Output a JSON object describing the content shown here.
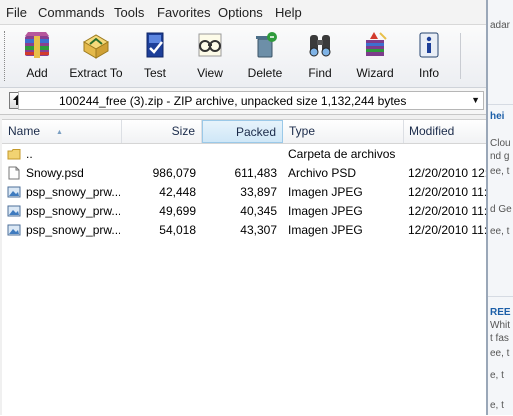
{
  "menu": [
    "File",
    "Commands",
    "Tools",
    "Favorites",
    "Options",
    "Help"
  ],
  "toolbar": [
    {
      "label": "Add",
      "icon": "add-icon"
    },
    {
      "label": "Extract To",
      "icon": "extract-to-icon"
    },
    {
      "label": "Test",
      "icon": "test-icon"
    },
    {
      "label": "View",
      "icon": "view-icon"
    },
    {
      "label": "Delete",
      "icon": "delete-icon"
    },
    {
      "label": "Find",
      "icon": "find-icon"
    },
    {
      "label": "Wizard",
      "icon": "wizard-icon"
    },
    {
      "label": "Info",
      "icon": "info-icon"
    }
  ],
  "path": {
    "text": "100244_free (3).zip - ZIP archive, unpacked size 1,132,244 bytes"
  },
  "columns": {
    "name": "Name",
    "size": "Size",
    "packed": "Packed",
    "type": "Type",
    "modified": "Modified"
  },
  "files": [
    {
      "name": "..",
      "size": "",
      "packed": "",
      "type": "Carpeta de archivos",
      "modified": "",
      "icon": "folder-icon"
    },
    {
      "name": "Snowy.psd",
      "size": "986,079",
      "packed": "611,483",
      "type": "Archivo PSD",
      "modified": "12/20/2010 12:",
      "icon": "file-icon"
    },
    {
      "name": "psp_snowy_prw...",
      "size": "42,448",
      "packed": "33,897",
      "type": "Imagen JPEG",
      "modified": "12/20/2010 11:",
      "icon": "image-file-icon"
    },
    {
      "name": "psp_snowy_prw...",
      "size": "49,699",
      "packed": "40,345",
      "type": "Imagen JPEG",
      "modified": "12/20/2010 11:",
      "icon": "image-file-icon"
    },
    {
      "name": "psp_snowy_prw...",
      "size": "54,018",
      "packed": "43,307",
      "type": "Imagen JPEG",
      "modified": "12/20/2010 11:",
      "icon": "image-file-icon"
    }
  ],
  "background": {
    "fragments": [
      "adar",
      "hei",
      "Clou",
      "nd g",
      "ee, t",
      "d Ge",
      "ee, t",
      "REE",
      "Whit",
      "t fas",
      "ee, t",
      "e, t",
      "e, t"
    ]
  },
  "colors": {
    "sorted_header": "#cfe7f7",
    "accent": "#1c5fa8"
  }
}
